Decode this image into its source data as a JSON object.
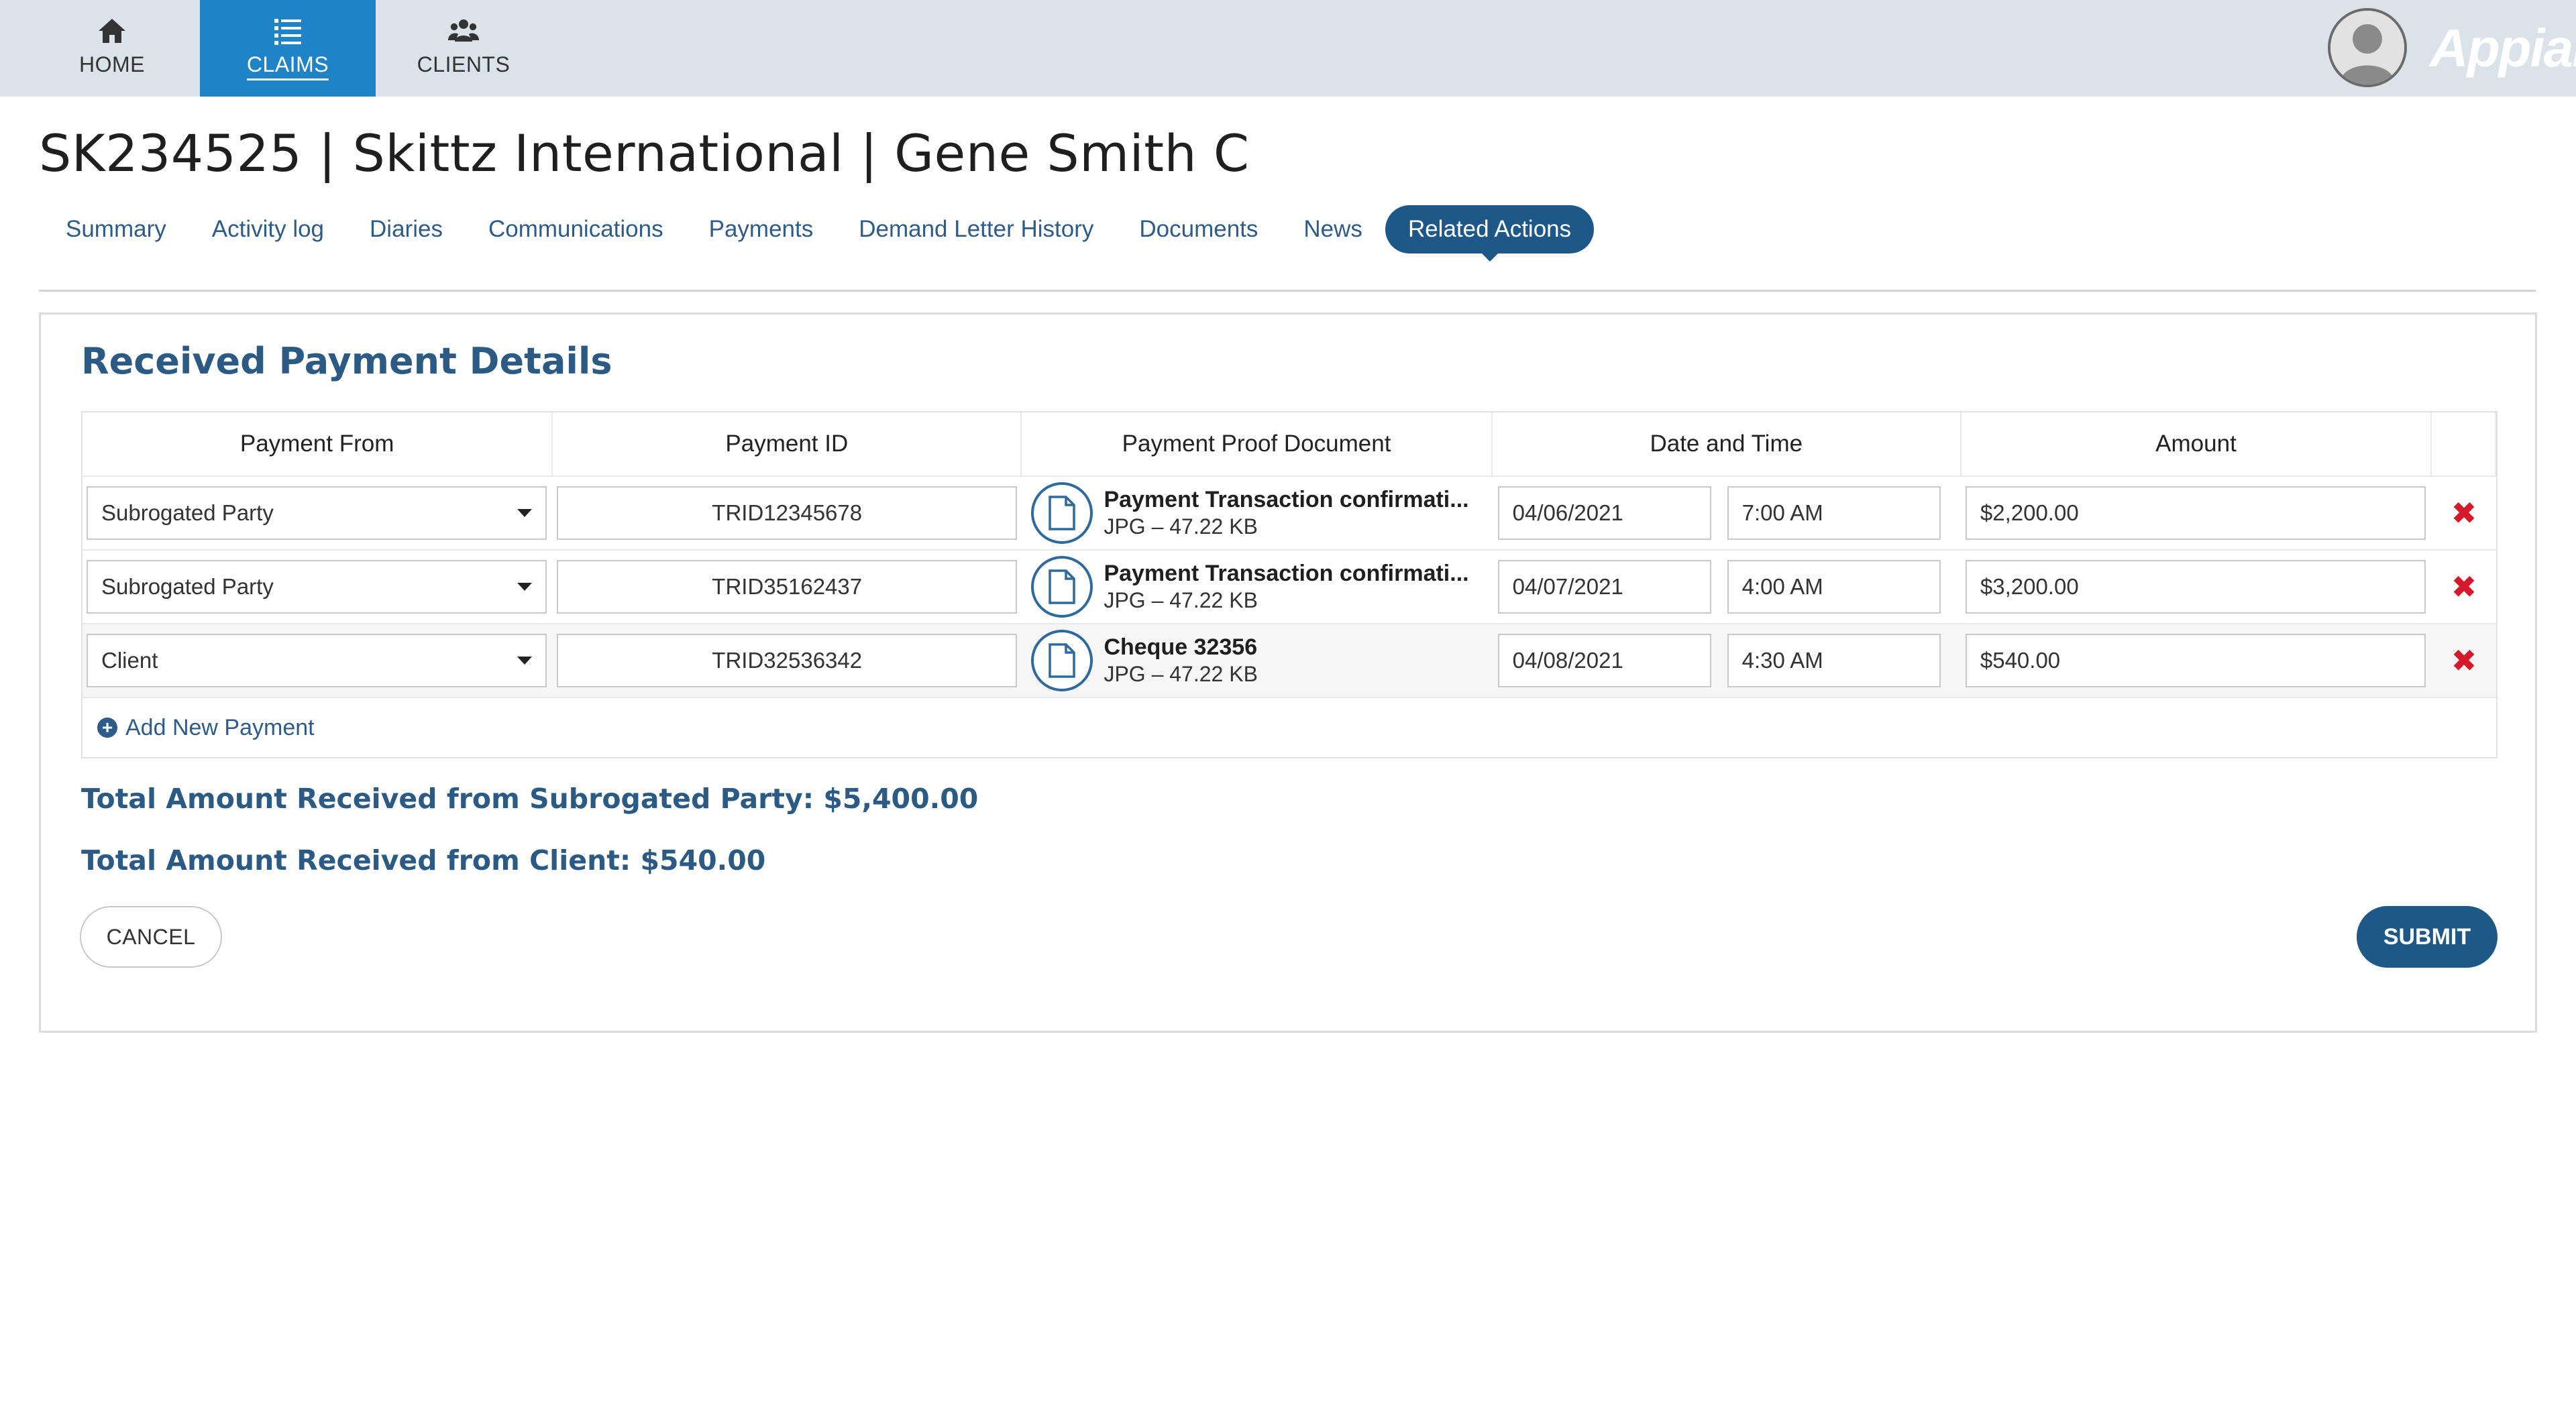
{
  "nav": {
    "items": [
      {
        "label": "HOME",
        "icon": "home-icon"
      },
      {
        "label": "CLAIMS",
        "icon": "list-icon",
        "active": true
      },
      {
        "label": "CLIENTS",
        "icon": "users-icon"
      }
    ],
    "brand": "Appian",
    "colors": {
      "topbar": "#dbe3ea",
      "active": "#1f83c7"
    }
  },
  "page": {
    "title": "SK234525 | Skittz International | Gene Smith C"
  },
  "tabs": [
    "Summary",
    "Activity log",
    "Diaries",
    "Communications",
    "Payments",
    "Demand Letter History",
    "Documents",
    "News",
    "Related Actions"
  ],
  "active_tab": "Related Actions",
  "form": {
    "title": "Received Payment Details",
    "columns": [
      "Payment From",
      "Payment ID",
      "Payment Proof Document",
      "Date and Time",
      "Amount"
    ],
    "rows": [
      {
        "from": "Subrogated Party",
        "id": "TRID12345678",
        "doc_name": "Payment Transaction confirmati...",
        "doc_meta": "JPG – 47.22 KB",
        "date": "04/06/2021",
        "time": "7:00 AM",
        "amount": "$2,200.00"
      },
      {
        "from": "Subrogated Party",
        "id": "TRID35162437",
        "doc_name": "Payment Transaction confirmati...",
        "doc_meta": "JPG – 47.22 KB",
        "date": "04/07/2021",
        "time": "4:00 AM",
        "amount": "$3,200.00"
      },
      {
        "from": "Client",
        "id": "TRID32536342",
        "doc_name": "Cheque 32356",
        "doc_meta": "JPG – 47.22 KB",
        "date": "04/08/2021",
        "time": "4:30 AM",
        "amount": "$540.00"
      }
    ],
    "add_label": "Add New Payment",
    "total_subrogated": "Total Amount Received from Subrogated Party: $5,400.00",
    "total_client": "Total Amount Received from Client: $540.00",
    "cancel_label": "CANCEL",
    "submit_label": "SUBMIT"
  }
}
